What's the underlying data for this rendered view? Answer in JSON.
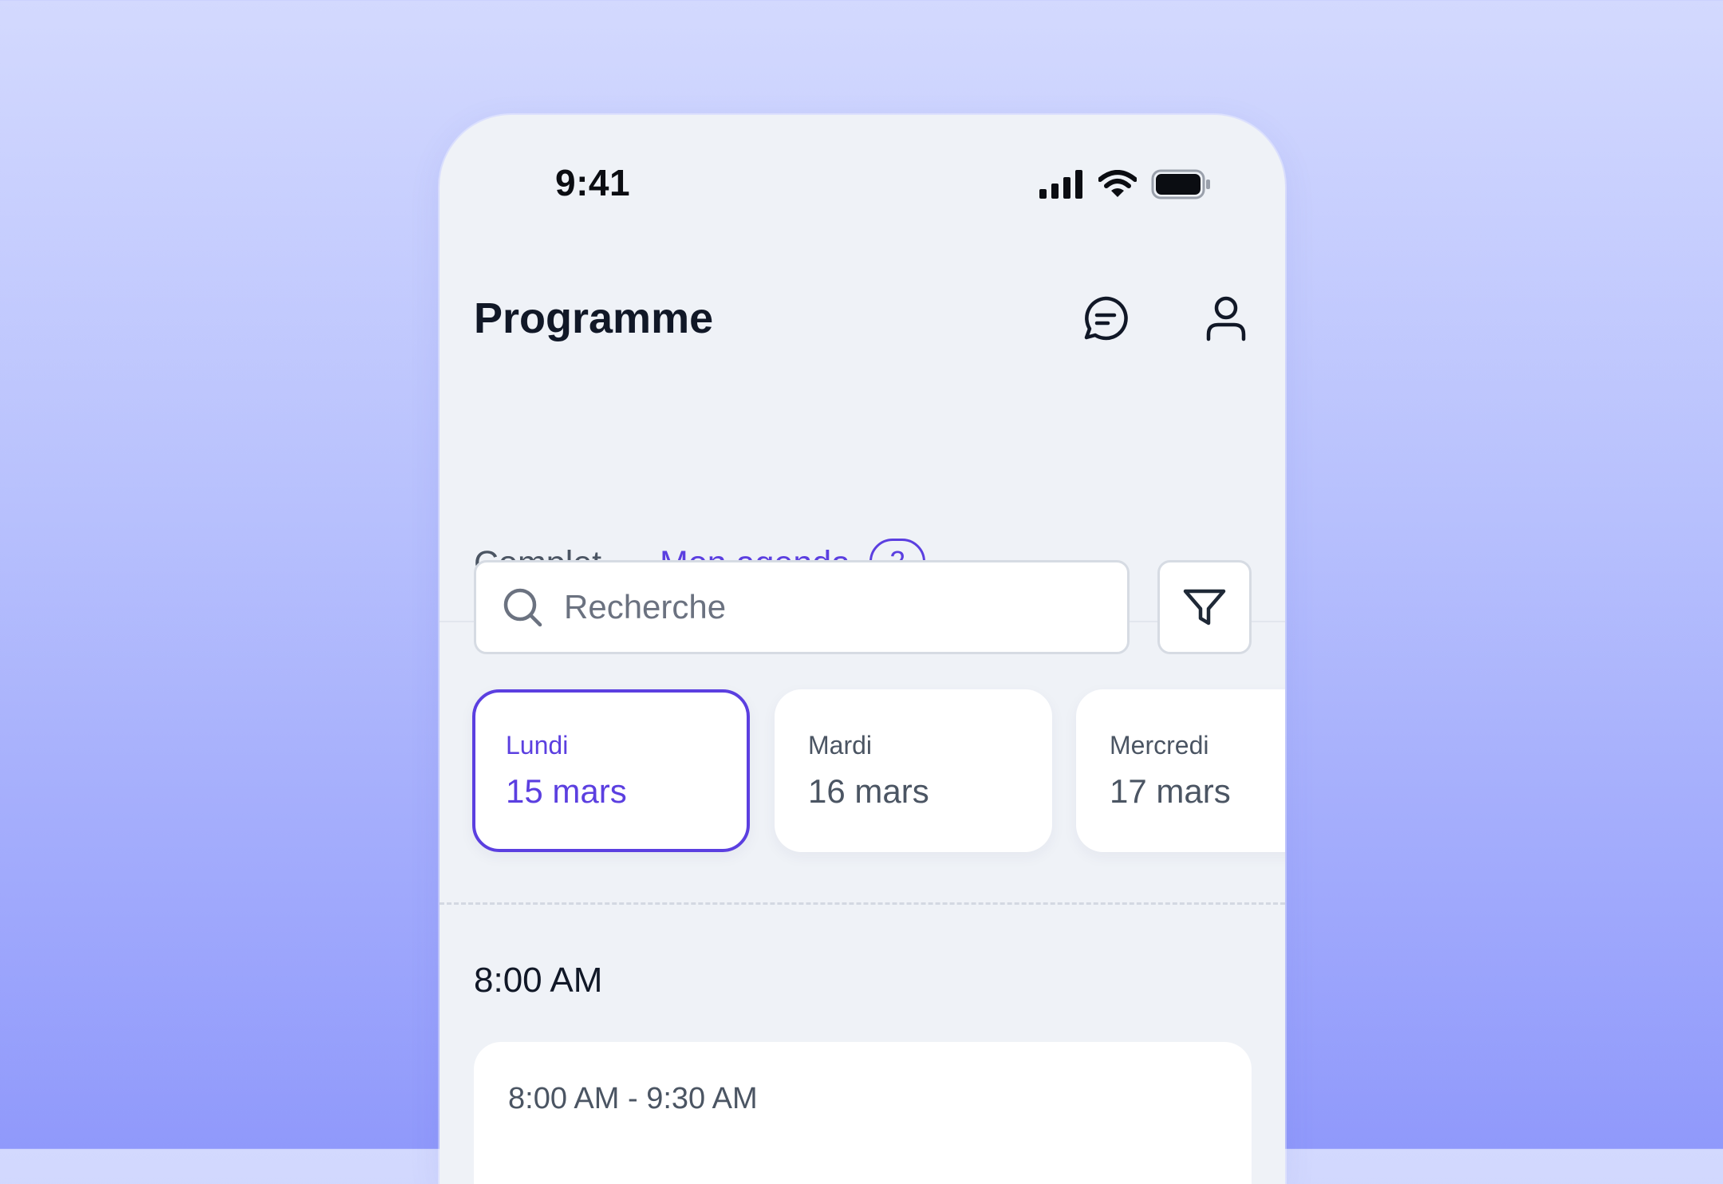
{
  "status_bar": {
    "time": "9:41"
  },
  "header": {
    "title": "Programme"
  },
  "tabs": [
    {
      "label": "Complet"
    },
    {
      "label": "Mon agenda",
      "badge": "2"
    }
  ],
  "search": {
    "placeholder": "Recherche"
  },
  "days": [
    {
      "day": "Lundi",
      "date": "15 mars",
      "selected": true
    },
    {
      "day": "Mardi",
      "date": "16 mars",
      "selected": false
    },
    {
      "day": "Mercredi",
      "date": "17 mars",
      "selected": false
    }
  ],
  "schedule": {
    "time_heading": "8:00 AM",
    "sessions": [
      {
        "time_range": "8:00 AM - 9:30 AM"
      }
    ]
  },
  "colors": {
    "accent": "#5b3fe0",
    "text": "#111827",
    "muted": "#4b5563",
    "screen_bg": "#eff2f7"
  }
}
